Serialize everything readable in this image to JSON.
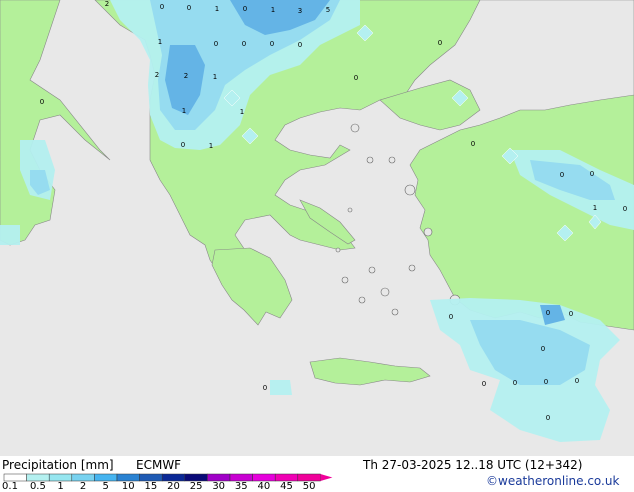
{
  "footer": {
    "title": "Precipitation [mm]",
    "model": "ECMWF",
    "datetime": "Th 27-03-2025 12..18 UTC (12+342)",
    "credit": "©weatheronline.co.uk"
  },
  "legend": {
    "ticks": [
      "0.1",
      "0.5",
      "1",
      "2",
      "5",
      "10",
      "15",
      "20",
      "25",
      "30",
      "35",
      "40",
      "45",
      "50"
    ],
    "colors": [
      "#ffffff",
      "#b4f0f0",
      "#96e6f0",
      "#78d2f0",
      "#46b4f0",
      "#2a82d2",
      "#1e5ab4",
      "#0a2896",
      "#0a0a78",
      "#a000c8",
      "#c800d2",
      "#e600dc",
      "#f000b4",
      "#f0009a"
    ]
  },
  "map_colors": {
    "sea": "#e8e8e8",
    "land": "#b4f09a",
    "rain_light": "#b4f0f0",
    "rain_mid": "#96dcf0",
    "rain_heavy": "#64b4e6"
  },
  "map_values": [
    "2",
    "0",
    "0",
    "1",
    "0",
    "1",
    "3",
    "5",
    "1",
    "0",
    "0",
    "0",
    "0",
    "0",
    "2",
    "2",
    "1",
    "0",
    "1",
    "1",
    "0",
    "0",
    "1",
    "0",
    "0",
    "0",
    "1",
    "0",
    "0",
    "0",
    "0",
    "0",
    "0",
    "0",
    "0",
    "0",
    "0",
    "0"
  ]
}
